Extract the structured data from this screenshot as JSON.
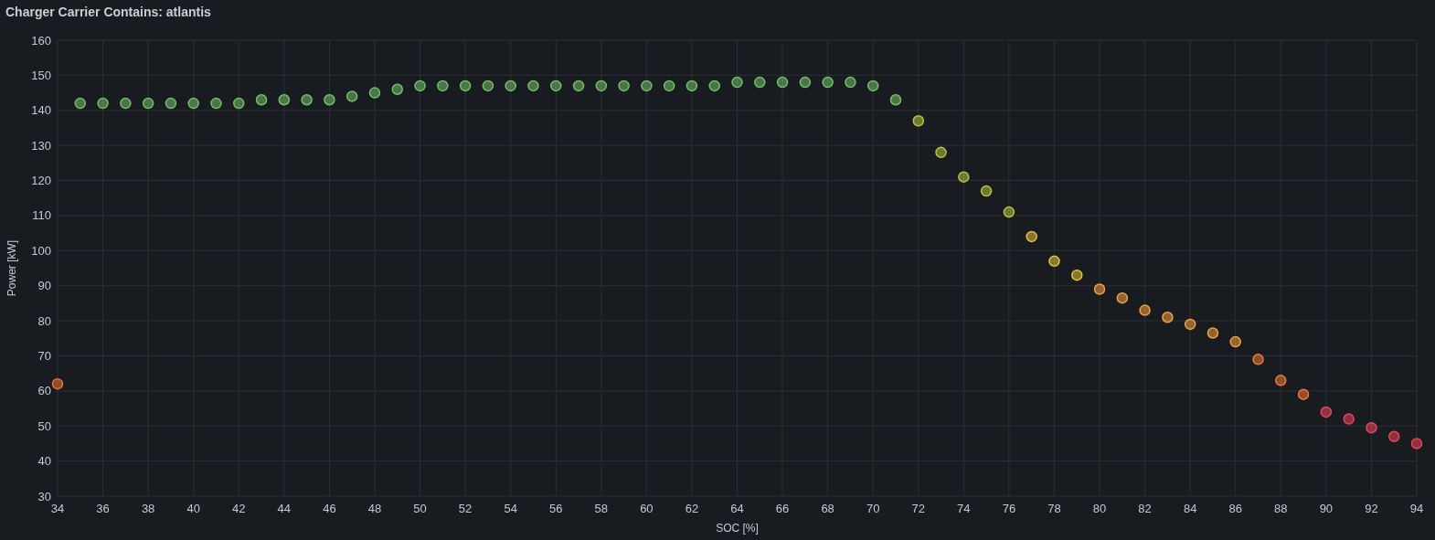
{
  "panel": {
    "title": "Charger Carrier Contains: atlantis",
    "chart_data": {
      "type": "scatter",
      "xlabel": "SOC [%]",
      "ylabel": "Power [kW]",
      "x": [
        34,
        35,
        36,
        37,
        38,
        39,
        40,
        41,
        42,
        43,
        44,
        45,
        46,
        47,
        48,
        49,
        50,
        51,
        52,
        53,
        54,
        55,
        56,
        57,
        58,
        59,
        60,
        61,
        62,
        63,
        64,
        65,
        66,
        67,
        68,
        69,
        70,
        71,
        72,
        73,
        74,
        75,
        76,
        77,
        78,
        79,
        80,
        81,
        82,
        83,
        84,
        85,
        86,
        87,
        88,
        89,
        90,
        91,
        92,
        93,
        94
      ],
      "series": [
        {
          "color": "#f0703a",
          "values": [
            62,
            null,
            null,
            null,
            null,
            null,
            null,
            null,
            null,
            null,
            null,
            null,
            null,
            null,
            null,
            null,
            null,
            null,
            null,
            null,
            null,
            null,
            null,
            null,
            null,
            null,
            null,
            null,
            null,
            null,
            null,
            null,
            null,
            null,
            null,
            null,
            null,
            null,
            null,
            null,
            null,
            null,
            null,
            null,
            null,
            null,
            null,
            null,
            null,
            null,
            null,
            null,
            null,
            null,
            null,
            null,
            null,
            null,
            null,
            null,
            null
          ]
        },
        {
          "color": "#73bf69",
          "values": [
            null,
            142,
            142,
            142,
            142,
            142,
            142,
            142,
            142,
            143,
            143,
            143,
            143,
            144,
            145,
            146,
            147,
            147,
            147,
            147,
            147,
            147,
            147,
            147,
            147,
            147,
            147,
            147,
            147,
            147,
            148,
            148,
            148,
            148,
            148,
            148,
            147,
            143,
            null,
            null,
            null,
            null,
            null,
            null,
            null,
            null,
            null,
            null,
            null,
            null,
            null,
            null,
            null,
            null,
            null,
            null,
            null,
            null,
            null,
            null,
            null
          ]
        },
        {
          "color": "#b7c43f",
          "values": [
            null,
            null,
            null,
            null,
            null,
            null,
            null,
            null,
            null,
            null,
            null,
            null,
            null,
            null,
            null,
            null,
            null,
            null,
            null,
            null,
            null,
            null,
            null,
            null,
            null,
            null,
            null,
            null,
            null,
            null,
            null,
            null,
            null,
            null,
            null,
            null,
            null,
            null,
            137,
            128,
            121,
            117,
            111,
            null,
            null,
            null,
            null,
            null,
            null,
            null,
            null,
            null,
            null,
            null,
            null,
            null,
            null,
            null,
            null,
            null,
            null
          ]
        },
        {
          "color": "#e5c33a",
          "values": [
            null,
            null,
            null,
            null,
            null,
            null,
            null,
            null,
            null,
            null,
            null,
            null,
            null,
            null,
            null,
            null,
            null,
            null,
            null,
            null,
            null,
            null,
            null,
            null,
            null,
            null,
            null,
            null,
            null,
            null,
            null,
            null,
            null,
            null,
            null,
            null,
            null,
            null,
            null,
            null,
            null,
            null,
            null,
            104,
            97,
            93,
            null,
            null,
            null,
            null,
            null,
            null,
            null,
            null,
            null,
            null,
            null,
            null,
            null,
            null,
            null
          ]
        },
        {
          "color": "#f2a03f",
          "values": [
            null,
            null,
            null,
            null,
            null,
            null,
            null,
            null,
            null,
            null,
            null,
            null,
            null,
            null,
            null,
            null,
            null,
            null,
            null,
            null,
            null,
            null,
            null,
            null,
            null,
            null,
            null,
            null,
            null,
            null,
            null,
            null,
            null,
            null,
            null,
            null,
            null,
            null,
            null,
            null,
            null,
            null,
            null,
            null,
            null,
            null,
            89,
            86.5,
            83,
            81,
            79,
            76.5,
            74,
            null,
            null,
            null,
            null,
            null,
            null,
            null,
            null
          ]
        },
        {
          "color": "#f07a3a",
          "values": [
            null,
            null,
            null,
            null,
            null,
            null,
            null,
            null,
            null,
            null,
            null,
            null,
            null,
            null,
            null,
            null,
            null,
            null,
            null,
            null,
            null,
            null,
            null,
            null,
            null,
            null,
            null,
            null,
            null,
            null,
            null,
            null,
            null,
            null,
            null,
            null,
            null,
            null,
            null,
            null,
            null,
            null,
            null,
            null,
            null,
            null,
            null,
            null,
            null,
            null,
            null,
            null,
            null,
            69,
            63,
            59,
            null,
            null,
            null,
            null,
            null
          ]
        },
        {
          "color": "#e8455a",
          "values": [
            null,
            null,
            null,
            null,
            null,
            null,
            null,
            null,
            null,
            null,
            null,
            null,
            null,
            null,
            null,
            null,
            null,
            null,
            null,
            null,
            null,
            null,
            null,
            null,
            null,
            null,
            null,
            null,
            null,
            null,
            null,
            null,
            null,
            null,
            null,
            null,
            null,
            null,
            null,
            null,
            null,
            null,
            null,
            null,
            null,
            null,
            null,
            null,
            null,
            null,
            null,
            null,
            null,
            null,
            null,
            null,
            54,
            52,
            49.5,
            47,
            45
          ]
        }
      ],
      "grid": true,
      "xlim": [
        34,
        94
      ],
      "ylim": [
        30,
        160
      ],
      "xticks": [
        34,
        36,
        38,
        40,
        42,
        44,
        46,
        48,
        50,
        52,
        54,
        56,
        58,
        60,
        62,
        64,
        66,
        68,
        70,
        72,
        74,
        76,
        78,
        80,
        82,
        84,
        86,
        88,
        90,
        92,
        94
      ],
      "yticks": [
        30,
        40,
        50,
        60,
        70,
        80,
        90,
        100,
        110,
        120,
        130,
        140,
        150,
        160
      ]
    }
  }
}
